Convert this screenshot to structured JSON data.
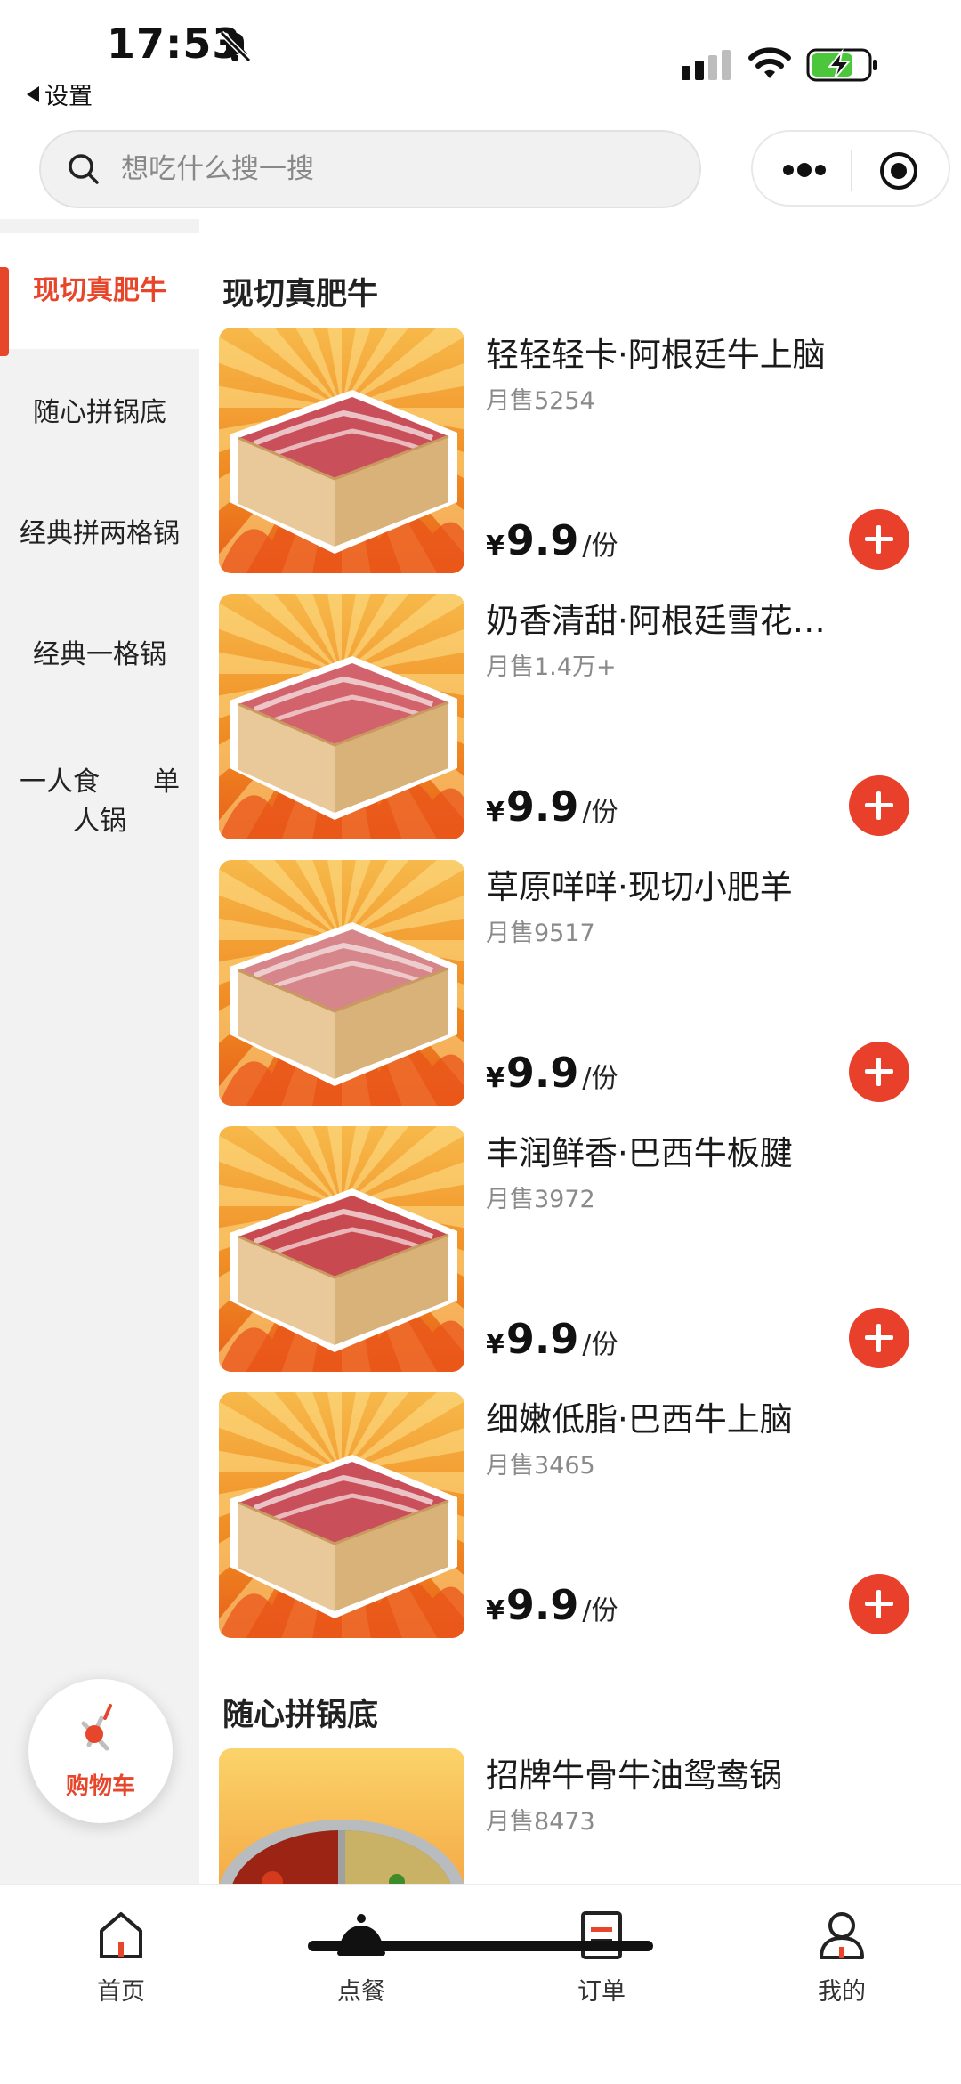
{
  "status_bar": {
    "time": "17:53",
    "back_label": "设置"
  },
  "search": {
    "placeholder": "想吃什么搜一搜"
  },
  "sidebar": {
    "items": [
      {
        "label": "现切真肥牛",
        "active": true
      },
      {
        "label": "随心拼锅底",
        "active": false
      },
      {
        "label": "经典拼两格锅",
        "active": false
      },
      {
        "label": "经典一格锅",
        "active": false
      },
      {
        "label": "一人食　　单人锅",
        "active": false
      }
    ]
  },
  "sections": [
    {
      "title": "现切真肥牛",
      "items": [
        {
          "name": "轻轻轻卡·阿根廷牛上脑",
          "sales": "月售5254",
          "currency": "¥",
          "price": "9.9",
          "unit": "/份"
        },
        {
          "name": "奶香清甜·阿根廷雪花…",
          "sales": "月售1.4万+",
          "currency": "¥",
          "price": "9.9",
          "unit": "/份"
        },
        {
          "name": "草原咩咩·现切小肥羊",
          "sales": "月售9517",
          "currency": "¥",
          "price": "9.9",
          "unit": "/份"
        },
        {
          "name": "丰润鲜香·巴西牛板腱",
          "sales": "月售3972",
          "currency": "¥",
          "price": "9.9",
          "unit": "/份"
        },
        {
          "name": "细嫩低脂·巴西牛上脑",
          "sales": "月售3465",
          "currency": "¥",
          "price": "9.9",
          "unit": "/份"
        }
      ]
    },
    {
      "title": "随心拼锅底",
      "items": [
        {
          "name": "招牌牛骨牛油鸳鸯锅",
          "sales": "月售8473"
        }
      ]
    }
  ],
  "cart": {
    "label": "购物车"
  },
  "tabbar": {
    "tabs": [
      {
        "label": "首页",
        "icon": "home-icon"
      },
      {
        "label": "点餐",
        "icon": "cloche-icon"
      },
      {
        "label": "订单",
        "icon": "order-icon"
      },
      {
        "label": "我的",
        "icon": "profile-icon"
      }
    ]
  },
  "colors": {
    "accent": "#e8462b",
    "add_button": "#e8402a",
    "sidebar_bg": "#f2f2f2"
  }
}
